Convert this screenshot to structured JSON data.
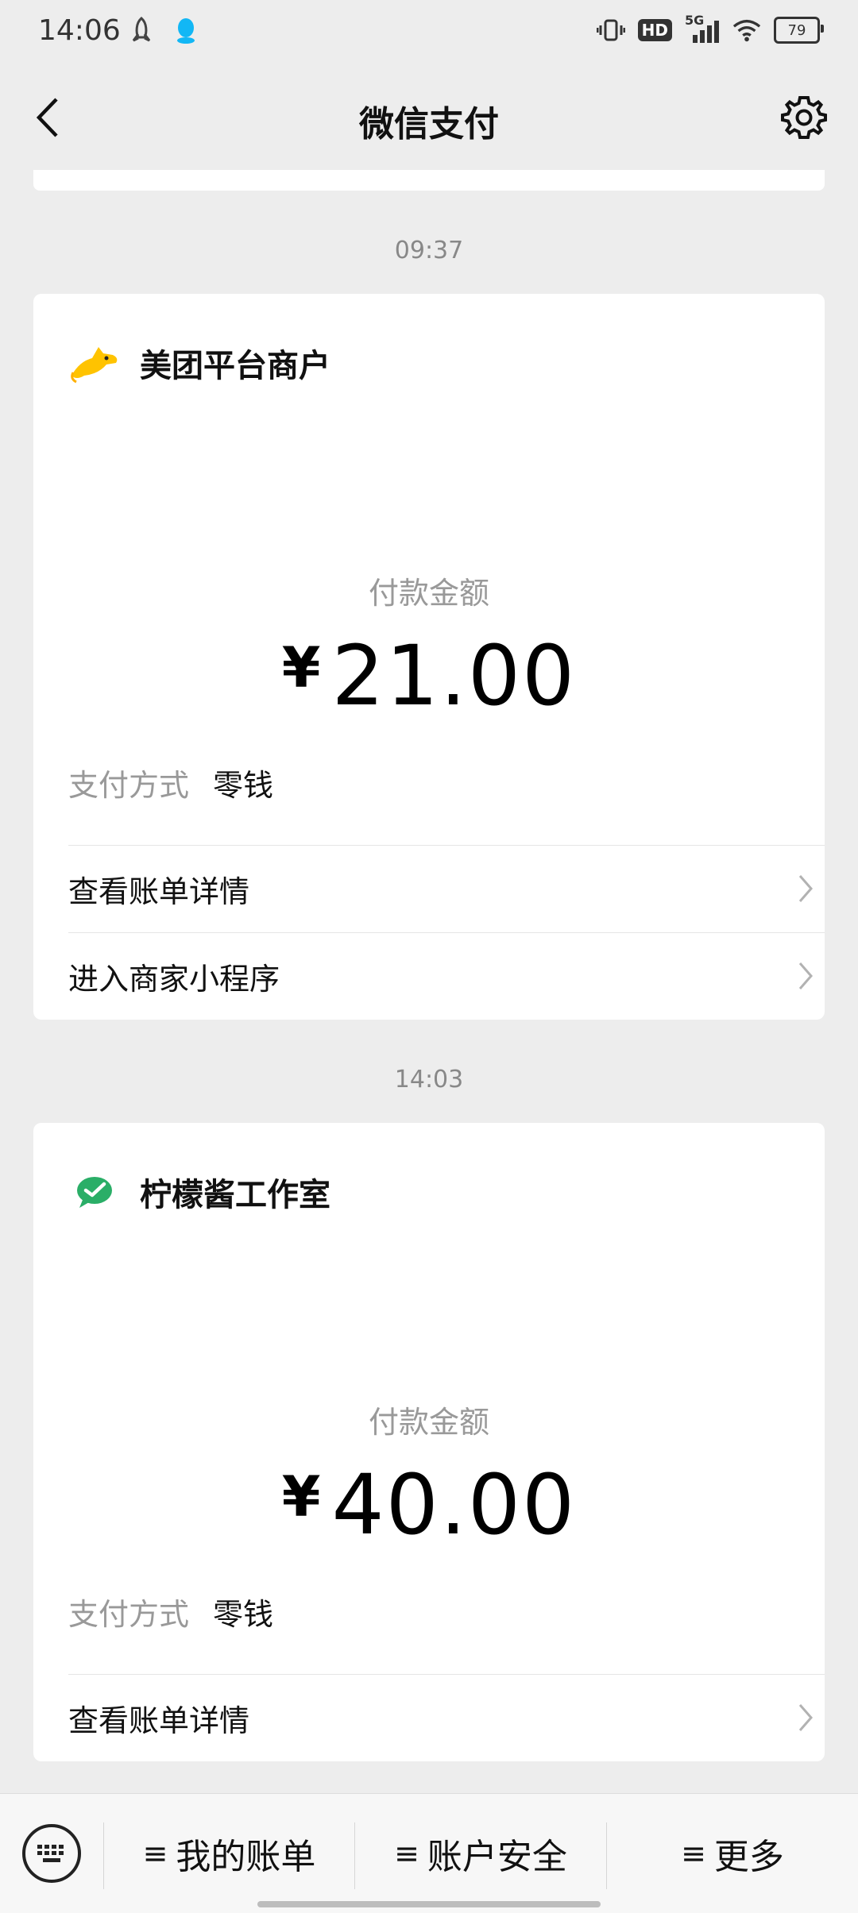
{
  "status_bar": {
    "time": "14:06",
    "network": "5G",
    "hd": "HD",
    "battery": "79"
  },
  "header": {
    "title": "微信支付"
  },
  "payments": [
    {
      "time": "09:37",
      "merchant": "美团平台商户",
      "amount_label": "付款金额",
      "currency": "¥",
      "amount": "21.00",
      "method_label": "支付方式",
      "method_value": "零钱",
      "links": [
        "查看账单详情",
        "进入商家小程序"
      ]
    },
    {
      "time": "14:03",
      "merchant": "柠檬酱工作室",
      "amount_label": "付款金额",
      "currency": "¥",
      "amount": "40.00",
      "method_label": "支付方式",
      "method_value": "零钱",
      "links": [
        "查看账单详情"
      ]
    }
  ],
  "bottom_bar": {
    "items": [
      "我的账单",
      "账户安全",
      "更多"
    ],
    "menu_glyph": "≡"
  },
  "colors": {
    "background": "#ededed",
    "card": "#ffffff",
    "wechat_green": "#2aae67",
    "meituan_yellow": "#ffc300"
  }
}
